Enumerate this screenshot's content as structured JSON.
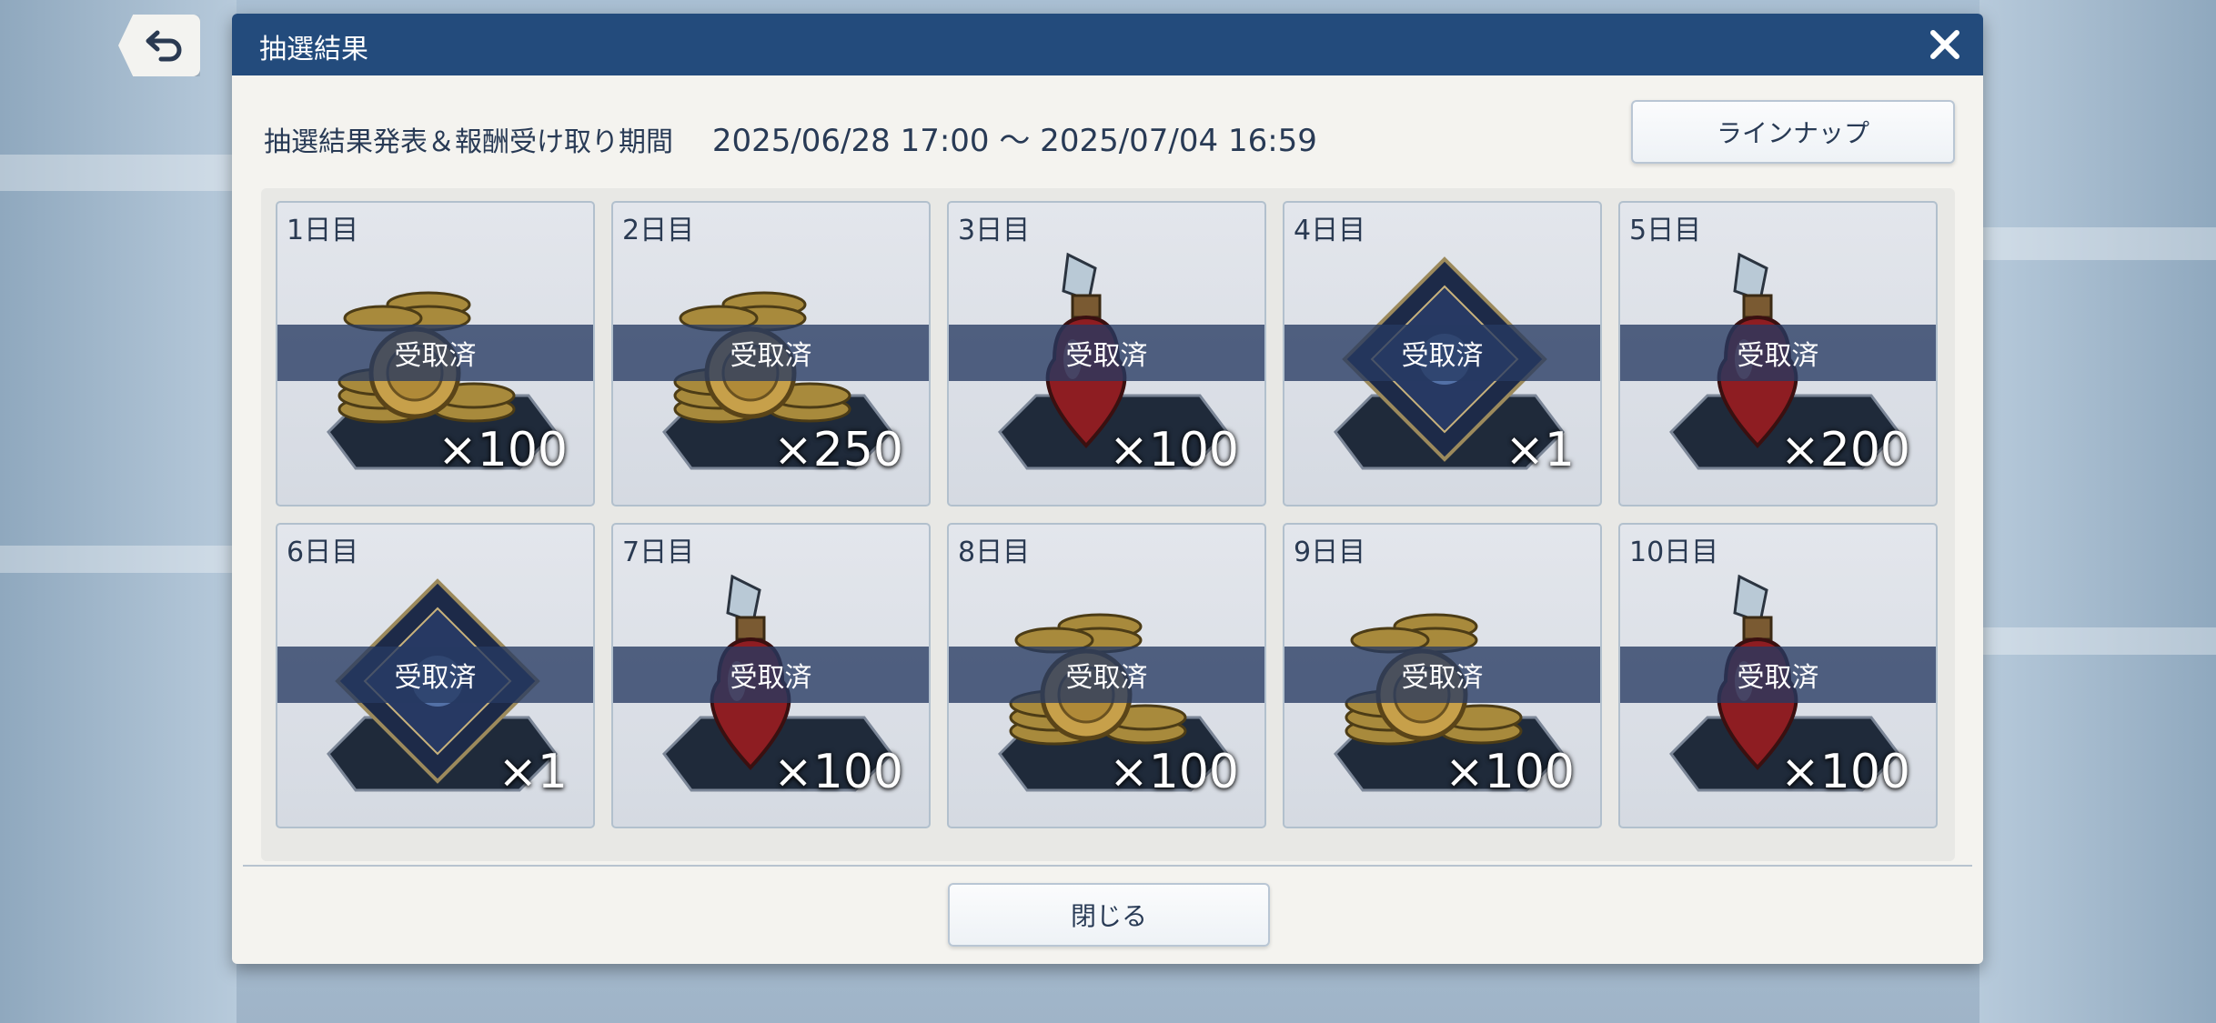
{
  "dialog": {
    "title": "抽選結果",
    "period_label": "抽選結果発表＆報酬受け取り期間",
    "period_value": "2025/06/28 17:00 ～ 2025/07/04 16:59",
    "lineup_button": "ラインナップ",
    "close_button": "閉じる"
  },
  "rewards": [
    {
      "day": "1日目",
      "item": "coin-stack-icon",
      "quantity": "×100",
      "status": "受取済"
    },
    {
      "day": "2日目",
      "item": "coin-stack-icon",
      "quantity": "×250",
      "status": "受取済"
    },
    {
      "day": "3日目",
      "item": "potion-icon",
      "quantity": "×100",
      "status": "受取済"
    },
    {
      "day": "4日目",
      "item": "crest-emblem-icon",
      "quantity": "×1",
      "status": "受取済"
    },
    {
      "day": "5日目",
      "item": "potion-icon",
      "quantity": "×200",
      "status": "受取済"
    },
    {
      "day": "6日目",
      "item": "crest-emblem-icon",
      "quantity": "×1",
      "status": "受取済"
    },
    {
      "day": "7日目",
      "item": "potion-icon",
      "quantity": "×100",
      "status": "受取済"
    },
    {
      "day": "8日目",
      "item": "coin-stack-icon",
      "quantity": "×100",
      "status": "受取済"
    },
    {
      "day": "9日目",
      "item": "coin-stack-icon",
      "quantity": "×100",
      "status": "受取済"
    },
    {
      "day": "10日目",
      "item": "potion-icon",
      "quantity": "×100",
      "status": "受取済"
    }
  ],
  "colors": {
    "titlebar": "#234b7c",
    "received_band": "#263a62",
    "text_dark": "#283a55"
  }
}
